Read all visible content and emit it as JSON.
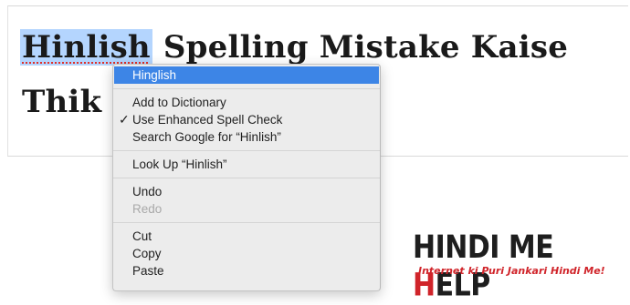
{
  "document": {
    "misspelled_word": "Hinlish",
    "heading_rest": " Spelling Mistake Kaise Thik kare"
  },
  "context_menu": {
    "suggestion": "Hinglish",
    "add_to_dictionary": "Add to Dictionary",
    "enhanced_spell_check": "Use Enhanced Spell Check",
    "enhanced_spell_check_checked": true,
    "check_mark": "✓",
    "search_google": "Search Google for “Hinlish”",
    "look_up": "Look Up “Hinlish”",
    "undo": "Undo",
    "redo": "Redo",
    "cut": "Cut",
    "copy": "Copy",
    "paste": "Paste"
  },
  "logo": {
    "name_part1": "HINDI ME ",
    "name_part2": "H",
    "name_part3": "ELP",
    "tagline": "Internet ki Puri Jankari Hindi Me!"
  },
  "colors": {
    "selection_highlight": "#b4d5fe",
    "menu_selected": "#3d85e6",
    "spell_underline": "#e0302a",
    "brand_red": "#d0242a"
  }
}
